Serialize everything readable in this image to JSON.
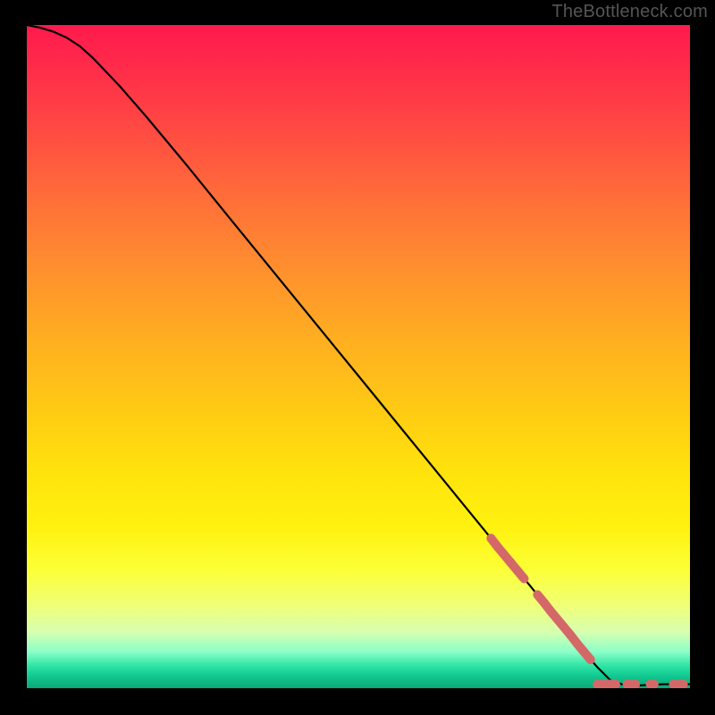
{
  "watermark": "TheBottleneck.com",
  "chart_data": {
    "type": "line",
    "title": "",
    "xlabel": "",
    "ylabel": "",
    "xlim": [
      0,
      100
    ],
    "ylim": [
      0,
      100
    ],
    "grid": false,
    "legend": false,
    "series": [
      {
        "name": "curve",
        "kind": "line",
        "color": "#000000",
        "x": [
          0,
          2,
          4,
          6,
          8,
          10,
          14,
          18,
          24,
          30,
          38,
          46,
          54,
          62,
          70,
          76,
          80,
          84,
          86,
          88,
          90,
          92,
          94,
          96,
          98,
          100
        ],
        "y": [
          100,
          99.6,
          99.0,
          98.1,
          96.8,
          95.0,
          90.8,
          86.2,
          79.0,
          71.6,
          61.8,
          52.0,
          42.2,
          32.4,
          22.6,
          15.3,
          10.4,
          5.5,
          3.2,
          1.2,
          0.5,
          0.4,
          0.5,
          0.6,
          0.6,
          0.6
        ]
      },
      {
        "name": "highlight-on-curve",
        "kind": "marker-segment",
        "color": "#d46868",
        "x": [
          70,
          71,
          72,
          73,
          74,
          75,
          77,
          78,
          79,
          80,
          81,
          82,
          83,
          84,
          85
        ],
        "y": [
          22.6,
          21.3,
          20.1,
          18.9,
          17.7,
          16.5,
          14.1,
          12.9,
          11.6,
          10.4,
          9.2,
          8.0,
          6.7,
          5.5,
          4.3
        ]
      },
      {
        "name": "flat-dashes",
        "kind": "dash",
        "color": "#d46868",
        "segments": [
          {
            "x0": 86.0,
            "x1": 88.8,
            "y": 0.6
          },
          {
            "x0": 90.5,
            "x1": 91.8,
            "y": 0.6
          },
          {
            "x0": 94.0,
            "x1": 94.6,
            "y": 0.6
          },
          {
            "x0": 97.5,
            "x1": 99.0,
            "y": 0.6
          }
        ]
      }
    ]
  }
}
